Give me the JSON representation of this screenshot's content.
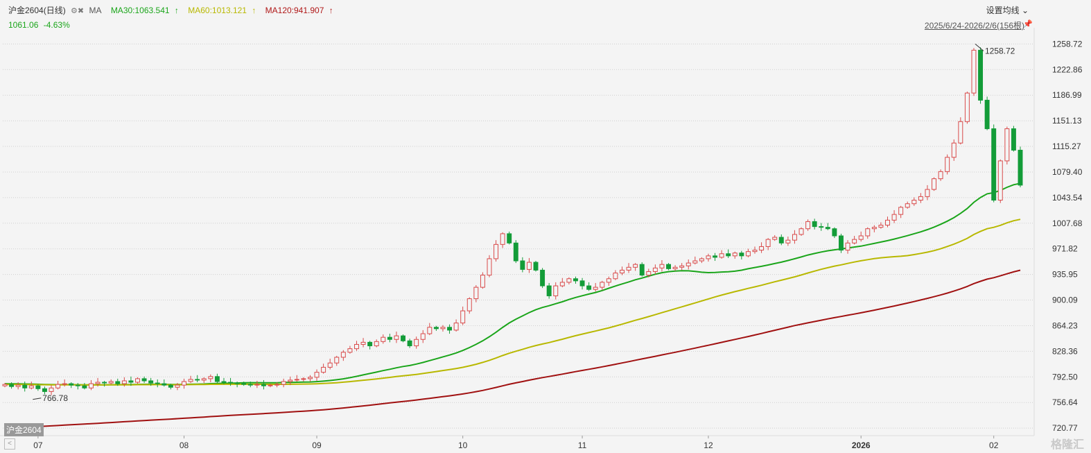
{
  "header": {
    "symbol": "沪金2604(日线)",
    "icons": "⚙✖",
    "ma_label": "MA",
    "ma30": "MA30:1063.541",
    "ma60": "MA60:1013.121",
    "ma120": "MA120:941.907",
    "up_arrow": "↑",
    "price": "1061.06",
    "change": "-4.63%"
  },
  "settings_label": "设置均线",
  "date_range": "2025/6/24-2026/2/6(156根)",
  "tag": "沪金2604",
  "watermark": "格隆汇",
  "colors": {
    "up": "#d94a4a",
    "down": "#139c38",
    "ma30": "#1aa51a",
    "ma60": "#b8b800",
    "ma120": "#a01010",
    "grid": "#cfcfcf"
  },
  "chart_data": {
    "type": "candlestick",
    "y_ticks": [
      "1258.72",
      "1222.86",
      "1186.99",
      "1151.13",
      "1115.27",
      "1079.40",
      "1043.54",
      "1007.68",
      "971.82",
      "935.95",
      "900.09",
      "864.23",
      "828.36",
      "792.50",
      "756.64",
      "720.77"
    ],
    "x_ticks": [
      {
        "label": "07",
        "index": 5
      },
      {
        "label": "08",
        "index": 27
      },
      {
        "label": "09",
        "index": 47
      },
      {
        "label": "10",
        "index": 69
      },
      {
        "label": "11",
        "index": 87
      },
      {
        "label": "12",
        "index": 106
      },
      {
        "label": "2026",
        "index": 129,
        "bold": true
      },
      {
        "label": "02",
        "index": 149
      }
    ],
    "annotations": [
      {
        "label": "1258.72",
        "index": 146,
        "value": 1258.72
      },
      {
        "label": "766.78",
        "index": 4,
        "value": 766.78
      }
    ],
    "ylim": [
      718.0,
      1262.0
    ],
    "close": [
      782,
      779,
      781,
      777,
      780,
      776,
      772,
      777,
      782,
      783,
      781,
      780,
      777,
      783,
      785,
      784,
      786,
      783,
      787,
      785,
      790,
      787,
      784,
      783,
      781,
      778,
      781,
      786,
      789,
      788,
      790,
      793,
      786,
      785,
      784,
      783,
      782,
      781,
      782,
      780,
      781,
      782,
      786,
      788,
      789,
      790,
      792,
      799,
      806,
      812,
      820,
      827,
      832,
      838,
      841,
      836,
      842,
      848,
      845,
      850,
      843,
      836,
      845,
      853,
      862,
      860,
      862,
      858,
      868,
      885,
      902,
      918,
      935,
      958,
      978,
      993,
      980,
      955,
      943,
      953,
      942,
      920,
      906,
      920,
      925,
      930,
      927,
      920,
      915,
      918,
      925,
      930,
      938,
      942,
      946,
      950,
      935,
      940,
      945,
      950,
      944,
      946,
      948,
      952,
      955,
      958,
      962,
      960,
      965,
      962,
      966,
      962,
      968,
      970,
      975,
      985,
      988,
      980,
      984,
      992,
      1000,
      1010,
      1003,
      1002,
      1000,
      990,
      970,
      980,
      985,
      990,
      1000,
      1002,
      1005,
      1012,
      1020,
      1030,
      1035,
      1040,
      1045,
      1055,
      1070,
      1080,
      1100,
      1120,
      1150,
      1190,
      1250,
      1180,
      1140,
      1040,
      1095,
      1140,
      1110,
      1061
    ],
    "ma30_start": 783,
    "ma60_start": 782,
    "ma120_start": 720,
    "ma30_last": 1063.541,
    "ma60_last": 1013.121,
    "ma120_last": 941.907
  }
}
